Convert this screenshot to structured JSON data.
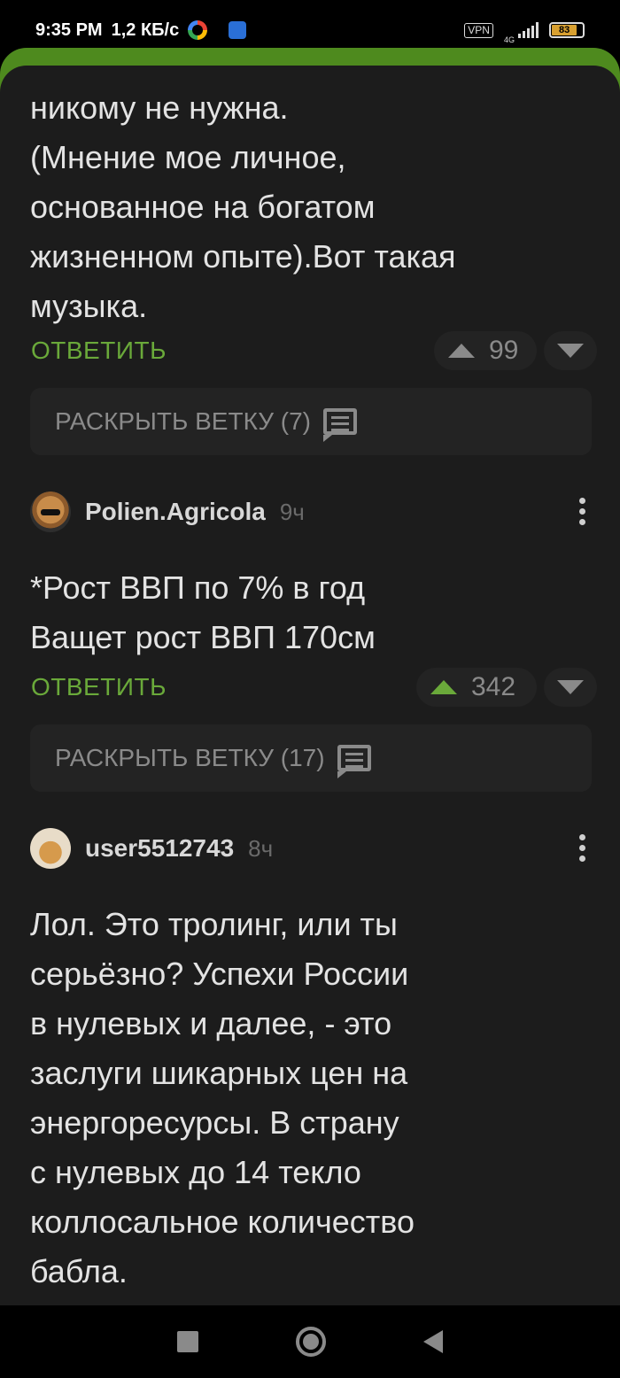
{
  "status_bar": {
    "time": "9:35 PM",
    "speed": "1,2 КБ/с",
    "vpn": "VPN",
    "network": "4G",
    "battery": "83",
    "icons": [
      "google-icon",
      "app-icon",
      "vpn-icon",
      "signal-icon",
      "battery-icon"
    ]
  },
  "comments": [
    {
      "text": "никому не нужна.\n(Мнение мое личное,\nоснованное на богатом\nжизненном опыте).Вот такая\nмузыка.",
      "reply_label": "ОТВЕТИТЬ",
      "votes": "99",
      "voted_up": false,
      "branch_label": "РАСКРЫТЬ ВЕТКУ (7)"
    },
    {
      "author": "Polien.Agricola",
      "time": "9ч",
      "text": "*Рост ВВП по 7% в год\nВащет рост ВВП 170см",
      "reply_label": "ОТВЕТИТЬ",
      "votes": "342",
      "voted_up": true,
      "branch_label": "РАСКРЫТЬ ВЕТКУ (17)"
    },
    {
      "author": "user5512743",
      "time": "8ч",
      "text": "Лол. Это тролинг, или ты\nсерьёзно? Успехи России\nв нулевых и далее, - это\nзаслуги шикарных цен на\nэнергоресурсы. В страну\nс нулевых до 14 текло\nколлосальное количество\nбабла."
    }
  ],
  "colors": {
    "accent_green": "#6aa93a",
    "header_green": "#4e8a1e",
    "background": "#1c1c1c"
  }
}
